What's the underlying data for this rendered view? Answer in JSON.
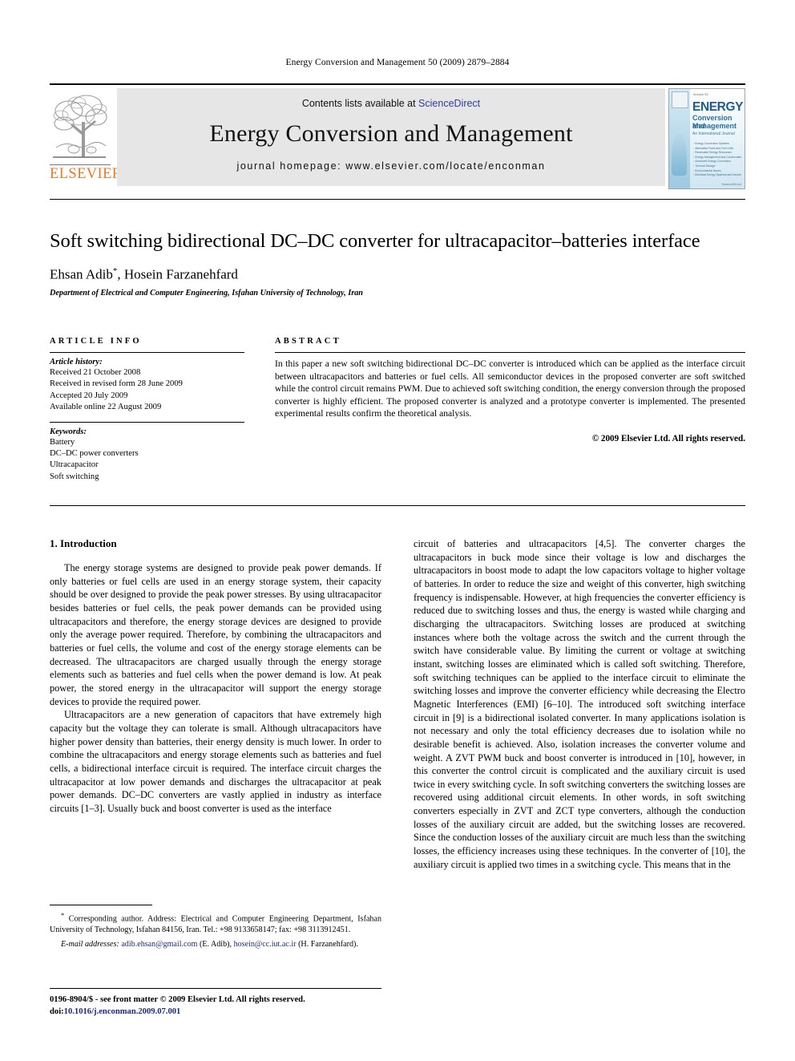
{
  "running_head": "Energy Conversion and Management 50 (2009) 2879–2884",
  "masthead": {
    "contents_prefix": "Contents lists available at ",
    "sciencedirect": "ScienceDirect",
    "journal_title": "Energy Conversion and Management",
    "homepage": "journal homepage: www.elsevier.com/locate/enconman",
    "publisher": "ELSEVIER",
    "accent_orange": "#E87B23",
    "link_blue": "#2b3f9e",
    "band_gray": "#e6e6e6",
    "cover": {
      "top_tiny": "Volume 50",
      "title": "ENERGY",
      "sub1": "Conversion and",
      "sub2": "Management",
      "sub3": "An International Journal",
      "toc": [
        "Energy Conversion Systems",
        "Alternative Fuels and Fuel Cells",
        "Renewable Energy Resources",
        "Energy Management and Conservation",
        "Advanced Energy Conversion",
        "Thermal Storage",
        "Environmental Issues",
        "Electrical Energy Systems and Devices"
      ],
      "imprint": "ScienceDirect"
    }
  },
  "article": {
    "title": "Soft switching bidirectional DC–DC converter for ultracapacitor–batteries interface",
    "authors": "Ehsan Adib",
    "corresponding_marker": "*",
    "authors_rest": ", Hosein Farzanehfard",
    "affiliation": "Department of Electrical and Computer Engineering, Isfahan University of Technology, Iran"
  },
  "article_info": {
    "heading": "ARTICLE INFO",
    "history_label": "Article history:",
    "history": [
      "Received 21 October 2008",
      "Received in revised form 28 June 2009",
      "Accepted 20 July 2009",
      "Available online 22 August 2009"
    ],
    "keywords_label": "Keywords:",
    "keywords": [
      "Battery",
      "DC–DC power converters",
      "Ultracapacitor",
      "Soft switching"
    ]
  },
  "abstract": {
    "heading": "ABSTRACT",
    "text": "In this paper a new soft switching bidirectional DC–DC converter is introduced which can be applied as the interface circuit between ultracapacitors and batteries or fuel cells. All semiconductor devices in the proposed converter are soft switched while the control circuit remains PWM. Due to achieved soft switching condition, the energy conversion through the proposed converter is highly efficient. The proposed converter is analyzed and a prototype converter is implemented. The presented experimental results confirm the theoretical analysis.",
    "copyright": "© 2009 Elsevier Ltd. All rights reserved."
  },
  "body": {
    "section_heading": "1. Introduction",
    "left_paragraphs": [
      "The energy storage systems are designed to provide peak power demands. If only batteries or fuel cells are used in an energy storage system, their capacity should be over designed to provide the peak power stresses. By using ultracapacitor besides batteries or fuel cells, the peak power demands can be provided using ultracapacitors and therefore, the energy storage devices are designed to provide only the average power required. Therefore, by combining the ultracapacitors and batteries or fuel cells, the volume and cost of the energy storage elements can be decreased. The ultracapacitors are charged usually through the energy storage elements such as batteries and fuel cells when the power demand is low. At peak power, the stored energy in the ultracapacitor will support the energy storage devices to provide the required power.",
      "Ultracapacitors are a new generation of capacitors that have extremely high capacity but the voltage they can tolerate is small. Although ultracapacitors have higher power density than batteries, their energy density is much lower. In order to combine the ultracapacitors and energy storage elements such as batteries and fuel cells, a bidirectional interface circuit is required. The interface circuit charges the ultracapacitor at low power demands and discharges the ultracapacitor at peak power demands. DC–DC converters are vastly applied in industry as interface circuits [1–3]. Usually buck and boost converter is used as the interface"
    ],
    "right_paragraph": "circuit of batteries and ultracapacitors [4,5]. The converter charges the ultracapacitors in buck mode since their voltage is low and discharges the ultracapacitors in boost mode to adapt the low capacitors voltage to higher voltage of batteries. In order to reduce the size and weight of this converter, high switching frequency is indispensable. However, at high frequencies the converter efficiency is reduced due to switching losses and thus, the energy is wasted while charging and discharging the ultracapacitors. Switching losses are produced at switching instances where both the voltage across the switch and the current through the switch have considerable value. By limiting the current or voltage at switching instant, switching losses are eliminated which is called soft switching. Therefore, soft switching techniques can be applied to the interface circuit to eliminate the switching losses and improve the converter efficiency while decreasing the Electro Magnetic Interferences (EMI) [6–10]. The introduced soft switching interface circuit in [9] is a bidirectional isolated converter. In many applications isolation is not necessary and only the total efficiency decreases due to isolation while no desirable benefit is achieved. Also, isolation increases the converter volume and weight. A ZVT PWM buck and boost converter is introduced in [10], however, in this converter the control circuit is complicated and the auxiliary circuit is used twice in every switching cycle. In soft switching converters the switching losses are recovered using additional circuit elements. In other words, in soft switching converters especially in ZVT and ZCT type converters, although the conduction losses of the auxiliary circuit are added, but the switching losses are recovered. Since the conduction losses of the auxiliary circuit are much less than the switching losses, the efficiency increases using these techniques. In the converter of [10], the auxiliary circuit is applied two times in a switching cycle. This means that in the"
  },
  "footnotes": {
    "corresponding_marker": "*",
    "corresponding_text": "Corresponding author. Address: Electrical and Computer Engineering Department, Isfahan University of Technology, Isfahan 84156, Iran. Tel.: +98 9133658147; fax: +98 3113912451.",
    "email_label": "E-mail addresses:",
    "email1": "adib.ehsan@gmail.com",
    "email1_owner": "(E. Adib)",
    "email2": "hosein@cc.iut.ac.ir",
    "email2_owner": "(H. Farzanehfard)."
  },
  "footer": {
    "issn_line": "0196-8904/$ - see front matter © 2009 Elsevier Ltd. All rights reserved.",
    "doi_label": "doi:",
    "doi_value": "10.1016/j.enconman.2009.07.001"
  }
}
